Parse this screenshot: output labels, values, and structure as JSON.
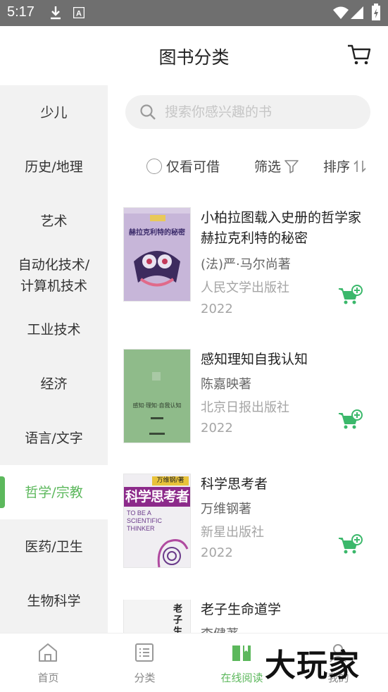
{
  "status_bar": {
    "time": "5:17"
  },
  "header": {
    "title": "图书分类"
  },
  "sidebar": {
    "items": [
      {
        "label": "少儿"
      },
      {
        "label": "历史/地理"
      },
      {
        "label": "艺术"
      },
      {
        "label": "自动化技术/\n计算机技术"
      },
      {
        "label": "工业技术"
      },
      {
        "label": "经济"
      },
      {
        "label": "语言/文字"
      },
      {
        "label": "哲学/宗教",
        "active": true
      },
      {
        "label": "医药/卫生"
      },
      {
        "label": "生物科学"
      }
    ]
  },
  "search": {
    "placeholder": "搜索你感兴趣的书"
  },
  "filters": {
    "available_only": "仅看可借",
    "filter": "筛选",
    "sort": "排序"
  },
  "books": [
    {
      "title": "小柏拉图载入史册的哲学家赫拉克利特的秘密",
      "author": "(法)严·马尔尚著",
      "publisher": "人民文学出版社",
      "year": "2022",
      "cover_text": "赫拉克利特的秘密",
      "cover_color": "#c9b7d8"
    },
    {
      "title": "感知理知自我认知",
      "author": "陈嘉映著",
      "publisher": "北京日报出版社",
      "year": "2022",
      "cover_text": "感知·理知·自我认知",
      "cover_color": "#8fbb8a"
    },
    {
      "title": "科学思考者",
      "author": "万维钢著",
      "publisher": "新星出版社",
      "year": "2022",
      "cover_text": "科学思考者",
      "cover_subtitle": "TO BE A SCIENTIFIC THINKER",
      "cover_author": "万维钢/著",
      "cover_color": "#f0eef2"
    },
    {
      "title": "老子生命道学",
      "author": "李健著",
      "cover_text": "老子生",
      "cover_color": "#f4f4f4"
    }
  ],
  "bottom_nav": {
    "items": [
      {
        "label": "首页",
        "icon": "home-icon"
      },
      {
        "label": "分类",
        "icon": "list-icon"
      },
      {
        "label": "在线阅读",
        "icon": "book-open-icon",
        "active": true
      },
      {
        "label": "我的",
        "icon": "user-icon"
      }
    ]
  },
  "watermark": "大玩家",
  "colors": {
    "accent": "#5cb85c",
    "status_bar": "#6f6f6f",
    "sidebar_bg": "#f2f2f2"
  }
}
